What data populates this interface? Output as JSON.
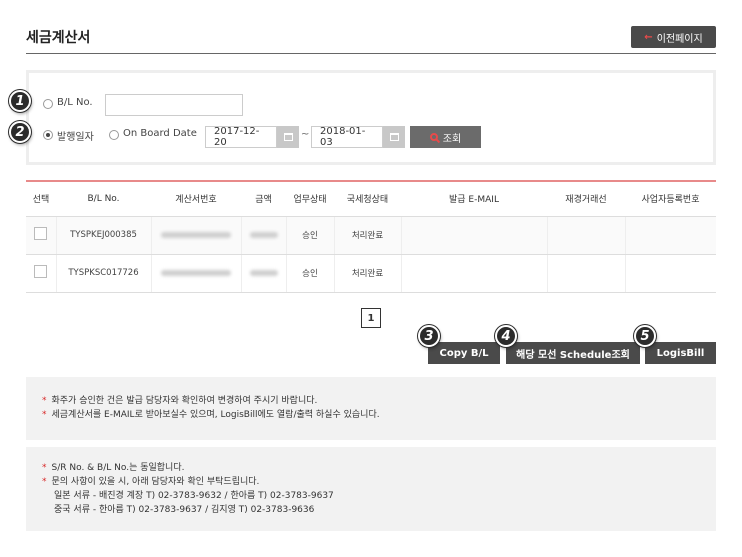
{
  "header": {
    "title": "세금계산서",
    "prev_button": "이전페이지",
    "prev_arrow": "←"
  },
  "search": {
    "markers": [
      "1",
      "2"
    ],
    "bl_label": "B/L No.",
    "bl_value": "",
    "issue_date_label": "발행일자",
    "onboard_label": "On Board Date",
    "selected": "issue_date",
    "date_from": "2017-12-20",
    "date_to": "2018-01-03",
    "tilde": "~",
    "search_button": "조회"
  },
  "table": {
    "headers": [
      "선택",
      "B/L No.",
      "계산서번호",
      "금액",
      "업무상태",
      "국세청상태",
      "발급 E-MAIL",
      "재경거래선",
      "사업자등록번호"
    ],
    "rows": [
      {
        "bl": "TYSPKEJ000385",
        "invoice": "",
        "amount": "",
        "work_status": "승인",
        "nts_status": "처리완료",
        "email": "",
        "partner": "",
        "biz_no": ""
      },
      {
        "bl": "TYSPKSC017726",
        "invoice": "",
        "amount": "",
        "work_status": "승인",
        "nts_status": "처리완료",
        "email": "",
        "partner": "",
        "biz_no": ""
      }
    ]
  },
  "pagination": {
    "current": "1"
  },
  "actions": {
    "markers": [
      "3",
      "4",
      "5"
    ],
    "copy_bl": "Copy B/L",
    "schedule": "해당 모선 Schedule조회",
    "logisbill": "LogisBill"
  },
  "notes1": [
    "화주가 승인한 건은 발급 담당자와 확인하여 변경하여 주시기 바랍니다.",
    "세금계산서를 E-MAIL로 받아보실수 있으며, LogisBill에도 열람/출력 하실수 있습니다."
  ],
  "notes2": [
    "S/R No. & B/L No.는 동일합니다.",
    "문의 사항이 있을 시, 아래 담당자와 확인 부탁드립니다."
  ],
  "contacts": [
    "일본 서류 - 배진경 계장 T) 02-3783-9632 / 한아름 T) 02-3783-9637",
    "중국 서류 - 한아름 T) 02-3783-9637 / 김지영 T) 02-3783-9636"
  ],
  "colors": {
    "accent": "#e84a4a",
    "dark_button": "#4a4a4a",
    "note_bg": "#f2f2f2"
  }
}
